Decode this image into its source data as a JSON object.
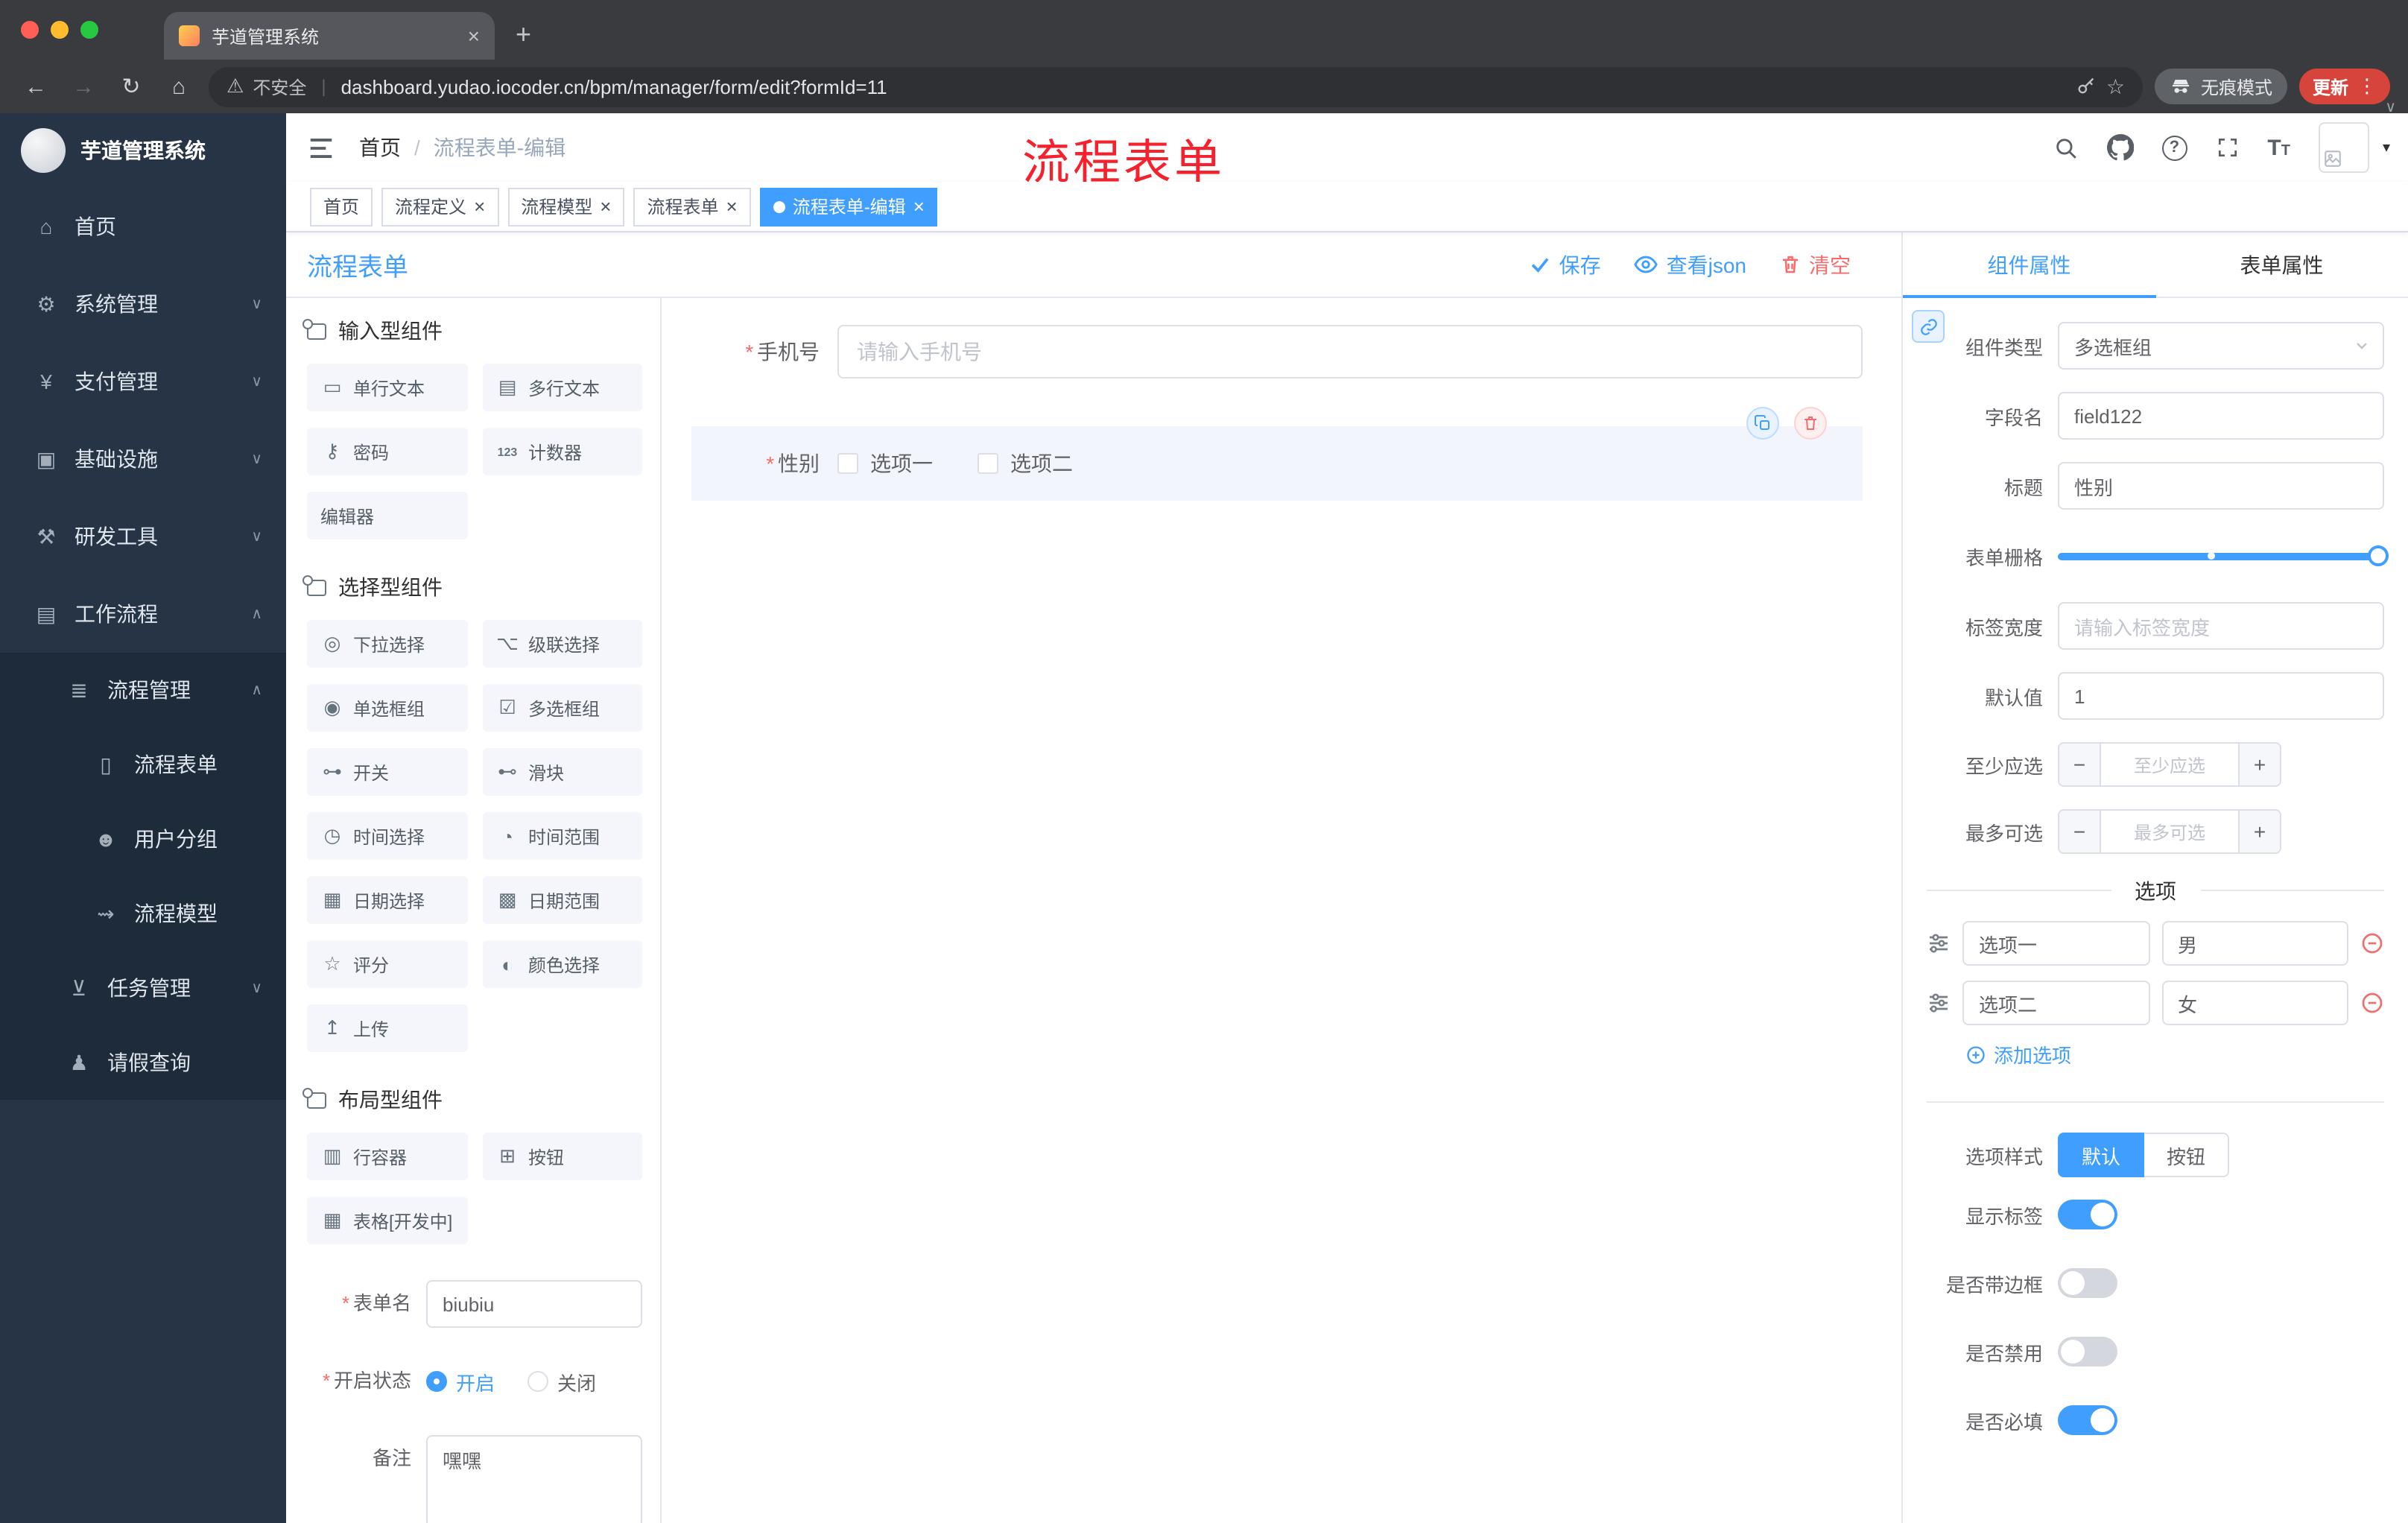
{
  "colors": {
    "accent": "#409eff",
    "danger": "#f56c6c",
    "annotation": "#f5222d"
  },
  "browser": {
    "tab": {
      "title": "芋道管理系统"
    },
    "address": {
      "security_label": "不安全",
      "url": "dashboard.yudao.iocoder.cn/bpm/manager/form/edit?formId=11"
    },
    "incognito_label": "无痕模式",
    "update_label": "更新"
  },
  "annotation": {
    "text": "流程表单",
    "color": "#f5222d"
  },
  "sidebar": {
    "logo_title": "芋道管理系统",
    "menu": [
      {
        "id": "home",
        "label": "首页",
        "icon": "dashboard-icon",
        "glyph": "⌂",
        "level": 1,
        "chevron": null,
        "active": false
      },
      {
        "id": "system-management",
        "label": "系统管理",
        "icon": "gear-icon",
        "glyph": "⚙",
        "level": 1,
        "chevron": "down",
        "active": false
      },
      {
        "id": "payment-management",
        "label": "支付管理",
        "icon": "yen-icon",
        "glyph": "¥",
        "level": 1,
        "chevron": "down",
        "active": false
      },
      {
        "id": "infrastructure",
        "label": "基础设施",
        "icon": "server-icon",
        "glyph": "▣",
        "level": 1,
        "chevron": "down",
        "active": false
      },
      {
        "id": "dev-tools",
        "label": "研发工具",
        "icon": "tools-icon",
        "glyph": "⚒",
        "level": 1,
        "chevron": "down",
        "active": false
      },
      {
        "id": "workflow",
        "label": "工作流程",
        "icon": "workflow-icon",
        "glyph": "▤",
        "level": 1,
        "chevron": "up",
        "active": false
      },
      {
        "id": "process-management",
        "label": "流程管理",
        "icon": "list-icon",
        "glyph": "≣",
        "level": 2,
        "chevron": "up",
        "active": false
      },
      {
        "id": "process-form",
        "label": "流程表单",
        "icon": "document-icon",
        "glyph": "▯",
        "level": 3,
        "chevron": null,
        "active": true
      },
      {
        "id": "user-group",
        "label": "用户分组",
        "icon": "users-icon",
        "glyph": "☻",
        "level": 3,
        "chevron": null,
        "active": false
      },
      {
        "id": "process-model",
        "label": "流程模型",
        "icon": "send-icon",
        "glyph": "⇝",
        "level": 3,
        "chevron": null,
        "active": false
      },
      {
        "id": "task-management",
        "label": "任务管理",
        "icon": "branch-icon",
        "glyph": "⊻",
        "level": 2,
        "chevron": "down",
        "active": false
      },
      {
        "id": "leave-query",
        "label": "请假查询",
        "icon": "user-icon",
        "glyph": "♟",
        "level": 2,
        "chevron": null,
        "active": false
      }
    ]
  },
  "header": {
    "breadcrumb": [
      "首页",
      "流程表单-编辑"
    ]
  },
  "tags": [
    {
      "id": "home",
      "label": "首页",
      "closable": false,
      "active": false
    },
    {
      "id": "process-definition",
      "label": "流程定义",
      "closable": true,
      "active": false
    },
    {
      "id": "process-model",
      "label": "流程模型",
      "closable": true,
      "active": false
    },
    {
      "id": "process-form",
      "label": "流程表单",
      "closable": true,
      "active": false
    },
    {
      "id": "process-form-edit",
      "label": "流程表单-编辑",
      "closable": true,
      "active": true
    }
  ],
  "designer": {
    "title": "流程表单",
    "save_label": "保存",
    "view_json_label": "查看json",
    "clear_label": "清空"
  },
  "palette": {
    "sections": [
      {
        "title": "输入型组件",
        "icon": "components-icon",
        "items": [
          {
            "id": "single-line-text",
            "label": "单行文本",
            "icon": "single-line-text-icon",
            "glyph": "▭"
          },
          {
            "id": "multi-line-text",
            "label": "多行文本",
            "icon": "multi-line-text-icon",
            "glyph": "▤"
          },
          {
            "id": "password",
            "label": "密码",
            "icon": "password-icon",
            "glyph": "⚷"
          },
          {
            "id": "counter",
            "label": "计数器",
            "icon": "counter-icon",
            "glyph": "123"
          },
          {
            "id": "editor",
            "label": "编辑器",
            "icon": null,
            "glyph": null
          }
        ]
      },
      {
        "title": "选择型组件",
        "icon": "components-icon",
        "items": [
          {
            "id": "select",
            "label": "下拉选择",
            "icon": "select-icon",
            "glyph": "◎"
          },
          {
            "id": "cascader",
            "label": "级联选择",
            "icon": "cascader-icon",
            "glyph": "⌥"
          },
          {
            "id": "radio-group",
            "label": "单选框组",
            "icon": "radio-icon",
            "glyph": "◉"
          },
          {
            "id": "checkbox-group",
            "label": "多选框组",
            "icon": "checkbox-icon",
            "glyph": "☑"
          },
          {
            "id": "switch",
            "label": "开关",
            "icon": "switch-icon",
            "glyph": "⊶"
          },
          {
            "id": "slider",
            "label": "滑块",
            "icon": "slider-icon",
            "glyph": "⊷"
          },
          {
            "id": "time-picker",
            "label": "时间选择",
            "icon": "time-icon",
            "glyph": "◷"
          },
          {
            "id": "time-range",
            "label": "时间范围",
            "icon": "time-range-icon",
            "glyph": "◔"
          },
          {
            "id": "date-picker",
            "label": "日期选择",
            "icon": "date-icon",
            "glyph": "▦"
          },
          {
            "id": "date-range",
            "label": "日期范围",
            "icon": "date-range-icon",
            "glyph": "▩"
          },
          {
            "id": "rate",
            "label": "评分",
            "icon": "star-icon",
            "glyph": "☆"
          },
          {
            "id": "color-picker",
            "label": "颜色选择",
            "icon": "color-icon",
            "glyph": "◐"
          },
          {
            "id": "upload",
            "label": "上传",
            "icon": "upload-icon",
            "glyph": "↥"
          }
        ]
      },
      {
        "title": "布局型组件",
        "icon": "components-icon",
        "items": [
          {
            "id": "row-container",
            "label": "行容器",
            "icon": "row-icon",
            "glyph": "▥"
          },
          {
            "id": "button",
            "label": "按钮",
            "icon": "button-icon",
            "glyph": "⊞"
          },
          {
            "id": "table",
            "label": "表格[开发中]",
            "icon": "table-icon",
            "glyph": "▦"
          }
        ]
      }
    ]
  },
  "form_meta": {
    "name_label": "表单名",
    "name_value": "biubiu",
    "status_label": "开启状态",
    "status_on": "开启",
    "status_off": "关闭",
    "remark_label": "备注",
    "remark_value": "嘿嘿"
  },
  "canvas": {
    "phone": {
      "label": "手机号",
      "placeholder": "请输入手机号",
      "required": true
    },
    "gender": {
      "label": "性别",
      "required": true,
      "options": [
        "选项一",
        "选项二"
      ]
    }
  },
  "properties": {
    "tabs": [
      "组件属性",
      "表单属性"
    ],
    "active_tab": "组件属性",
    "component_type_label": "组件类型",
    "component_type_value": "多选框组",
    "field_name_label": "字段名",
    "field_name_value": "field122",
    "title_label": "标题",
    "title_value": "性别",
    "grid_label": "表单栅格",
    "grid_slider": {
      "value_percent": 100,
      "stop_percent": 48
    },
    "label_width_label": "标签宽度",
    "label_width_placeholder": "请输入标签宽度",
    "default_label": "默认值",
    "default_value": "1",
    "min_label": "至少应选",
    "min_placeholder": "至少应选",
    "max_label": "最多可选",
    "max_placeholder": "最多可选",
    "options_divider_label": "选项",
    "options": [
      {
        "label": "选项一",
        "value": "男"
      },
      {
        "label": "选项二",
        "value": "女"
      }
    ],
    "add_option_label": "添加选项",
    "style_label": "选项样式",
    "style_options": [
      "默认",
      "按钮"
    ],
    "style_active": "默认",
    "switches": [
      {
        "id": "show-label",
        "label": "显示标签",
        "on": true
      },
      {
        "id": "with-border",
        "label": "是否带边框",
        "on": false
      },
      {
        "id": "disabled",
        "label": "是否禁用",
        "on": false
      },
      {
        "id": "required",
        "label": "是否必填",
        "on": true
      }
    ]
  }
}
